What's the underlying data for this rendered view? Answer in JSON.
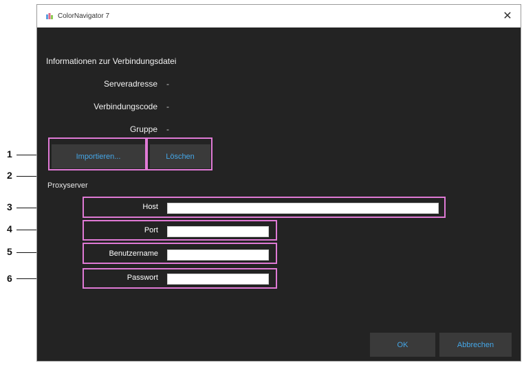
{
  "window": {
    "title": "ColorNavigator 7",
    "close_glyph": "✕"
  },
  "connection": {
    "heading": "Informationen zur Verbindungsdatei",
    "rows": [
      {
        "label": "Serveradresse",
        "value": "-"
      },
      {
        "label": "Verbindungscode",
        "value": "-"
      },
      {
        "label": "Gruppe",
        "value": "-"
      }
    ],
    "import_label": "Importieren...",
    "delete_label": "Löschen"
  },
  "proxy": {
    "heading": "Proxyserver",
    "host_label": "Host",
    "host_value": "",
    "port_label": "Port",
    "port_value": "",
    "user_label": "Benutzername",
    "user_value": "",
    "password_label": "Passwort",
    "password_value": ""
  },
  "footer": {
    "ok_label": "OK",
    "cancel_label": "Abbrechen"
  },
  "callouts": [
    "1",
    "2",
    "3",
    "4",
    "5",
    "6"
  ],
  "colors": {
    "background": "#232323",
    "accent": "#45a7e8",
    "highlight": "#e07ad6"
  },
  "icons": {
    "app": "colornavigator-icon",
    "close": "close-icon"
  }
}
